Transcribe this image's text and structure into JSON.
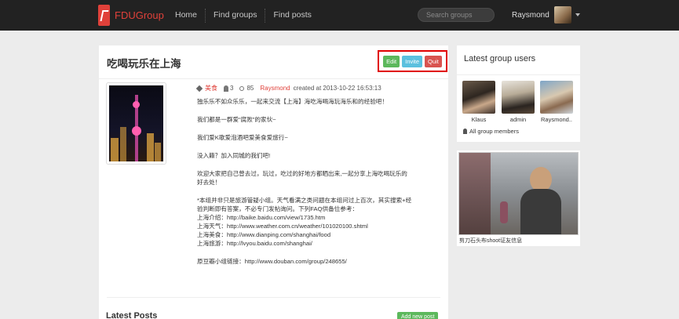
{
  "navbar": {
    "brand": "FDUGroup",
    "links": [
      "Home",
      "Find groups",
      "Find posts"
    ],
    "search_placeholder": "Search groups",
    "user_name": "Raysmond",
    "icons": [
      "fdugroup-logo-icon",
      "chevron-down-icon"
    ]
  },
  "group": {
    "title": "吃喝玩乐在上海",
    "actions": {
      "edit": "Edit",
      "invite": "Invite",
      "quit": "Quit"
    },
    "tag": "美食",
    "member_count": "3",
    "view_count": "85",
    "creator": "Raysmond",
    "created_text": "created at 2013-10-22 16:53:13",
    "description": [
      "独乐乐不如众乐乐，一起来交流【上海】海吃海喝海玩海乐和的经验吧！",
      "我们都是一群爱“腐败”的家伙~",
      "我们爱K歌爱泡酒吧爱美食爱旅行~",
      "没入籍？加入同城的我们吧!",
      "欢迎大家把自己曾去过，玩过，吃过的好地方都晒出来,一起分享上海吃喝玩乐的",
      "好去处！",
      "*本组并非只是旅游管疑小组。天气看满之类问题在本组问过上百次，其实搜索+经",
      "验判断即有答案，不必专门发帖询问。下列FAQ供备位参考：",
      "上海介绍：http://baike.baidu.com/view/1735.htm",
      "上海天气：http://www.weather.com.cn/weather/101020100.shtml",
      "上海美食：http://www.dianping.com/shanghai/food",
      "上海旅游：http://lvyou.baidu.com/shanghai/",
      "原豆瓣小组链接：http://www.douban.com/group/248655/"
    ],
    "latest_posts_title": "Latest Posts",
    "add_post_label": "Add new post"
  },
  "sidebar": {
    "users_title": "Latest group users",
    "members": [
      {
        "name": "Klaus"
      },
      {
        "name": "admin"
      },
      {
        "name": "Raysmond.."
      }
    ],
    "all_members_label": "All group members",
    "photo_caption": "剪刀石头布shoot证友信息"
  },
  "colors": {
    "accent": "#e0413a",
    "navbar": "#222222",
    "success": "#5cb85c",
    "info": "#5bc0de",
    "danger": "#d9534f"
  }
}
